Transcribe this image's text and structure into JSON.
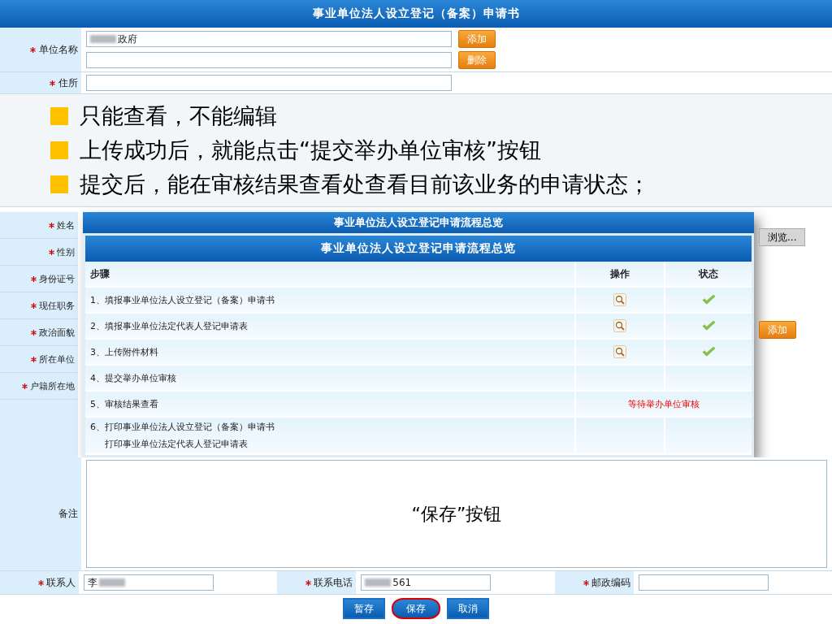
{
  "form_title": "事业单位法人设立登记（备案）申请书",
  "unit_name": {
    "label": "单位名称",
    "required": true,
    "values": [
      {
        "text": "政府",
        "redacted_prefix": true
      },
      {
        "redacted_prefix": false
      }
    ],
    "buttons": [
      "添加",
      "删除"
    ]
  },
  "address": {
    "label": "住所",
    "required": true
  },
  "bullets": [
    "只能查看，不能编辑",
    "上传成功后，就能点击“提交举办单位审核”按钮",
    "提交后，能在审核结果查看处查看目前该业务的申请状态；"
  ],
  "person_labels": [
    {
      "label": "姓名",
      "required": true
    },
    {
      "label": "性别",
      "required": true
    },
    {
      "label": "身份证号",
      "required": true
    },
    {
      "label": "现任职务",
      "required": true
    },
    {
      "label": "政治面貌",
      "required": true
    },
    {
      "label": "所在单位",
      "required": true
    },
    {
      "label": "户籍所在地",
      "required": true
    }
  ],
  "photo_browse_button": "浏览...",
  "side_add_button": "添加",
  "flow_dialog": {
    "back_title": "事业单位法人设立登记申请流程总览",
    "title": "事业单位法人设立登记申请流程总览",
    "columns": [
      "步骤",
      "操作",
      "状态"
    ],
    "steps": [
      {
        "lines": [
          "1、填报事业单位法人设立登记（备案）申请书"
        ],
        "viewable": true,
        "done": true
      },
      {
        "lines": [
          "2、填报事业单位法定代表人登记申请表"
        ],
        "viewable": true,
        "done": true
      },
      {
        "lines": [
          "3、上传附件材料"
        ],
        "viewable": true,
        "done": true
      },
      {
        "lines": [
          "4、提交举办单位审核"
        ],
        "viewable": false,
        "done": false
      },
      {
        "lines": [
          "5、审核结果查看"
        ],
        "status_text": "等待举办单位审核"
      },
      {
        "lines": [
          "6、打印事业单位法人设立登记（备案）申请书",
          "打印事业单位法定代表人登记申请表"
        ],
        "viewable": false,
        "done": false
      }
    ]
  },
  "remark": {
    "label": "备注",
    "caption": "“保存”按钮"
  },
  "contacts": [
    {
      "label": "联系人",
      "required": true,
      "value": "李",
      "redacted_suffix": true
    },
    {
      "label": "联系电话",
      "required": true,
      "value": "561",
      "redacted_prefix": true
    },
    {
      "label": "邮政编码",
      "required": true
    }
  ],
  "actions": [
    {
      "label": "暂存",
      "highlighted": false
    },
    {
      "label": "保存",
      "highlighted": true
    },
    {
      "label": "取消",
      "highlighted": false
    }
  ]
}
